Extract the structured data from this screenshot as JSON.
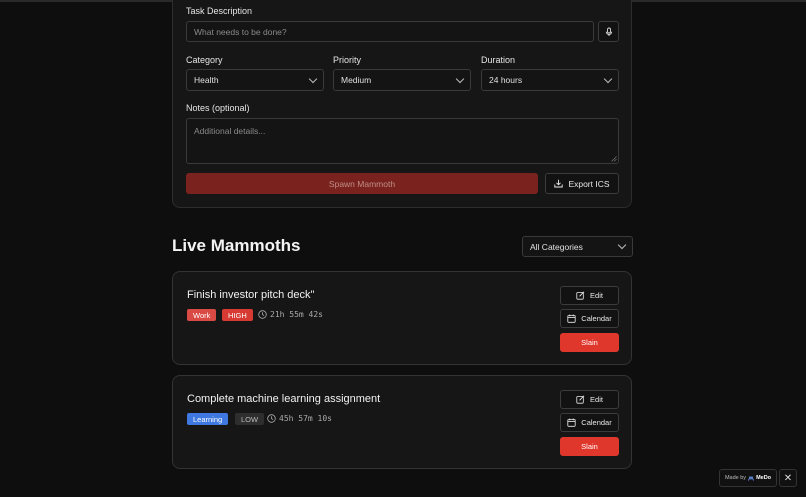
{
  "form": {
    "task_label": "Task Description",
    "task_placeholder": "What needs to be done?",
    "category_label": "Category",
    "category_value": "Health",
    "priority_label": "Priority",
    "priority_value": "Medium",
    "duration_label": "Duration",
    "duration_value": "24 hours",
    "notes_label": "Notes (optional)",
    "notes_placeholder": "Additional details...",
    "spawn_label": "Spawn Mammoth",
    "export_label": "Export ICS"
  },
  "list": {
    "title": "Live Mammoths",
    "filter_value": "All Categories",
    "items": [
      {
        "title": "Finish investor pitch deck\"",
        "category": "Work",
        "priority": "HIGH",
        "timer": "21h 55m 42s",
        "edit_label": "Edit",
        "calendar_label": "Calendar",
        "slain_label": "Slain"
      },
      {
        "title": "Complete machine learning assignment",
        "category": "Learning",
        "priority": "LOW",
        "timer": "45h 57m 10s",
        "edit_label": "Edit",
        "calendar_label": "Calendar",
        "slain_label": "Slain"
      }
    ]
  },
  "footer": {
    "made_by": "Made by",
    "brand": "MeDo",
    "close": "✕"
  },
  "colors": {
    "work_badge": "#d94a44",
    "high_badge": "#d63a33",
    "learning_badge": "#3f78e0",
    "low_badge": "#2e2e2e",
    "slain": "#e0372c",
    "spawn": "#7a231e"
  }
}
